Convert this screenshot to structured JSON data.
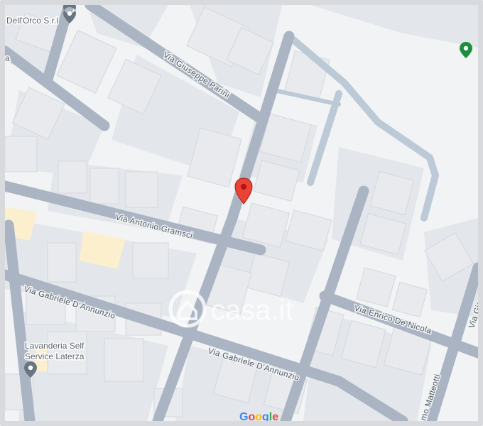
{
  "map": {
    "roads": {
      "via_giuseppe_parini": "Via Giuseppe Parini",
      "via_antonio_gramsci": "Via Antonio Gramsci",
      "via_gabriele_dannunzio": "Via Gabriele D'Annunzio",
      "via_enrico_de_nicola": "Via Enrico De Nicola",
      "corso_matteotti_fragment": "mo Matteotti",
      "via_giac_fragment": "Via Giaco"
    },
    "pois": {
      "dellorco": "Dell'Orco S.r.l",
      "lavanderia_line1": "Lavanderia Self",
      "lavanderia_line2": "Service Laterza",
      "top_left_fragment": "a"
    },
    "watermark": "casa.it",
    "attribution": [
      "G",
      "o",
      "o",
      "g",
      "l",
      "e"
    ],
    "colors": {
      "pin": "#ea4335",
      "poi_grey": "#6b7580",
      "poi_green": "#1e8e3e",
      "highlight_yellow": "#fcefcd",
      "google_blue": "#4285f4",
      "google_red": "#ea4335",
      "google_yellow": "#fbbc05",
      "google_green": "#34a853"
    },
    "icons": [
      "location-pin-icon",
      "poi-marker-icon",
      "casa-logo-icon"
    ]
  }
}
